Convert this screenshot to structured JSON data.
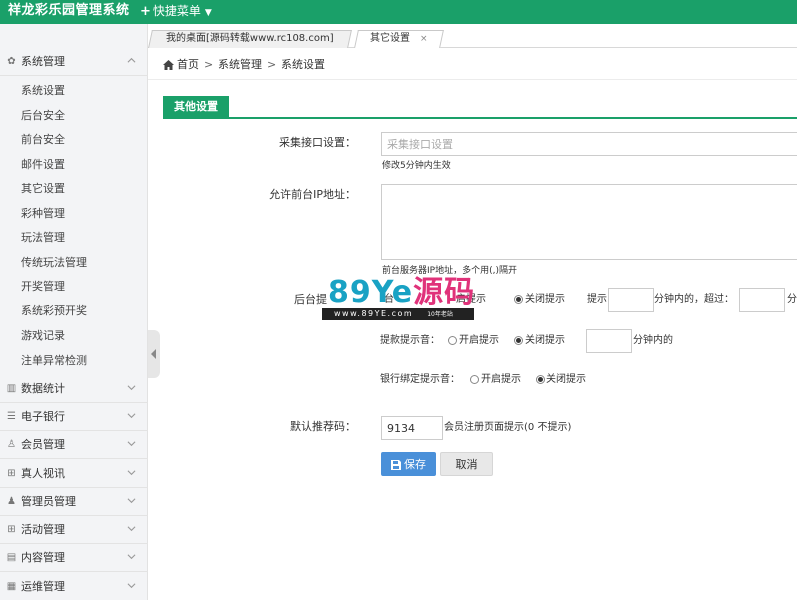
{
  "header": {
    "app_title": "祥龙彩乐园管理系统",
    "quick_menu_label": "快捷菜单"
  },
  "sidebar": {
    "system_group": "系统管理",
    "system_items": [
      "系统设置",
      "后台安全",
      "前台安全",
      "邮件设置",
      "其它设置",
      "彩种管理",
      "玩法管理",
      "传统玩法管理",
      "开奖管理",
      "系统彩预开奖",
      "游戏记录",
      "注单异常检测"
    ],
    "groups": [
      "数据统计",
      "电子银行",
      "会员管理",
      "真人视讯",
      "管理员管理",
      "活动管理",
      "内容管理",
      "运维管理"
    ]
  },
  "tabs": {
    "home_tab": "我的桌面[源码转载www.rc108.com]",
    "active_tab": "其它设置",
    "close_symbol": "×"
  },
  "breadcrumb": {
    "home": "首页",
    "level1": "系统管理",
    "level2": "系统设置",
    "separator": ">"
  },
  "section": {
    "title": "其他设置"
  },
  "form": {
    "collect_api_label": "采集接口设置：",
    "collect_api_placeholder": "采集接口设置",
    "collect_api_help": "修改5分钟内生效",
    "allow_ip_label": "允许前台IP地址：",
    "allow_ip_help": "前台服务器IP地址，多个用(,)隔开",
    "backend_alert_label": "后台提",
    "backend_alert_partial": "台",
    "backend_alert_on_partial": "启提示",
    "backend_alert_off": "关闭提示",
    "reminder_prefix": "提示",
    "minutes_within_exceed": "分钟内的，超过：",
    "minutes_trailing": "分",
    "withdraw_label": "提款提示音：",
    "withdraw_on": "开启提示",
    "withdraw_off": "关闭提示",
    "withdraw_minutes": "分钟内的",
    "bank_bind_label": "银行绑定提示音：",
    "bank_bind_on": "开启提示",
    "bank_bind_off": "关闭提示",
    "ref_code_label": "默认推荐码：",
    "ref_code_value": "9134",
    "ref_code_help": "会员注册页面提示(0 不提示)",
    "save_label": "保存",
    "cancel_label": "取消"
  },
  "watermark": {
    "logo_num": "89",
    "logo_latin": "Ye",
    "logo_cn": "源码",
    "url": "www.89YE.com",
    "sub": "10年老站"
  },
  "colors": {
    "brand_green": "#1aa069",
    "save_blue": "#4a90d9"
  }
}
